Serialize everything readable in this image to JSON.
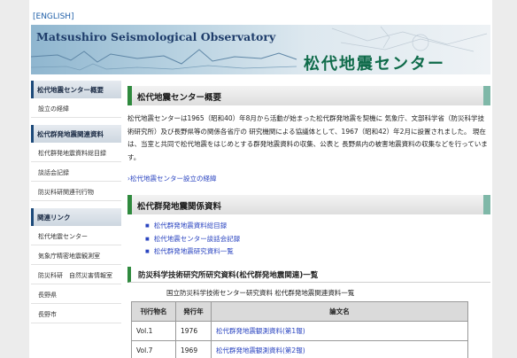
{
  "header": {
    "lang_link": "[ENGLISH]",
    "banner_en": "Matsushiro Seismological Observatory",
    "banner_jp": "松代地震センター"
  },
  "sidebar": {
    "sections": [
      {
        "title": "松代地震センター概要",
        "items": [
          "設立の経緯"
        ]
      },
      {
        "title": "松代群発地震関連資料",
        "items": [
          "松代群発地震資料総目録",
          "談話会記録",
          "防災科研関連刊行物"
        ]
      },
      {
        "title": "関連リンク",
        "items": [
          "松代地震センター",
          "気象庁精密地震観測室",
          "防災科研　自然災害情報室",
          "長野県",
          "長野市"
        ]
      }
    ]
  },
  "main": {
    "section1": {
      "title": "松代地震センター概要",
      "body": "松代地震センターは1965（昭和40）年8月から活動が始まった松代群発地震を契機に 気象庁、文部科学省（防災科学技術研究所）及び長野県等の関係各省庁の 研究機関による協議体として、1967（昭和42）年2月に設置されました。 現在は、当室と共同で松代地震をはじめとする群発地震資料の収集、公表と 長野県内の被害地震資料の収集などを行っています。",
      "link": "›松代地震センター設立の経緯"
    },
    "section2": {
      "title": "松代群発地震関係資料",
      "links": [
        "松代群発地震資料総目録",
        "松代地震センター談話会記録",
        "松代群発地震研究資料一覧"
      ],
      "sub_title": "防災科学技術研究所研究資料(松代群発地震関連)一覧",
      "caption": "国立防災科学技術センター研究資料 松代群発地震関連資料一覧",
      "table": {
        "headers": [
          "刊行物名",
          "発行年",
          "論文名"
        ],
        "rows": [
          [
            "Vol.1",
            "1976",
            "松代群発地震観測資料(第1報)"
          ],
          [
            "Vol.7",
            "1969",
            "松代群発地震観測資料(第2報)"
          ]
        ]
      }
    }
  }
}
